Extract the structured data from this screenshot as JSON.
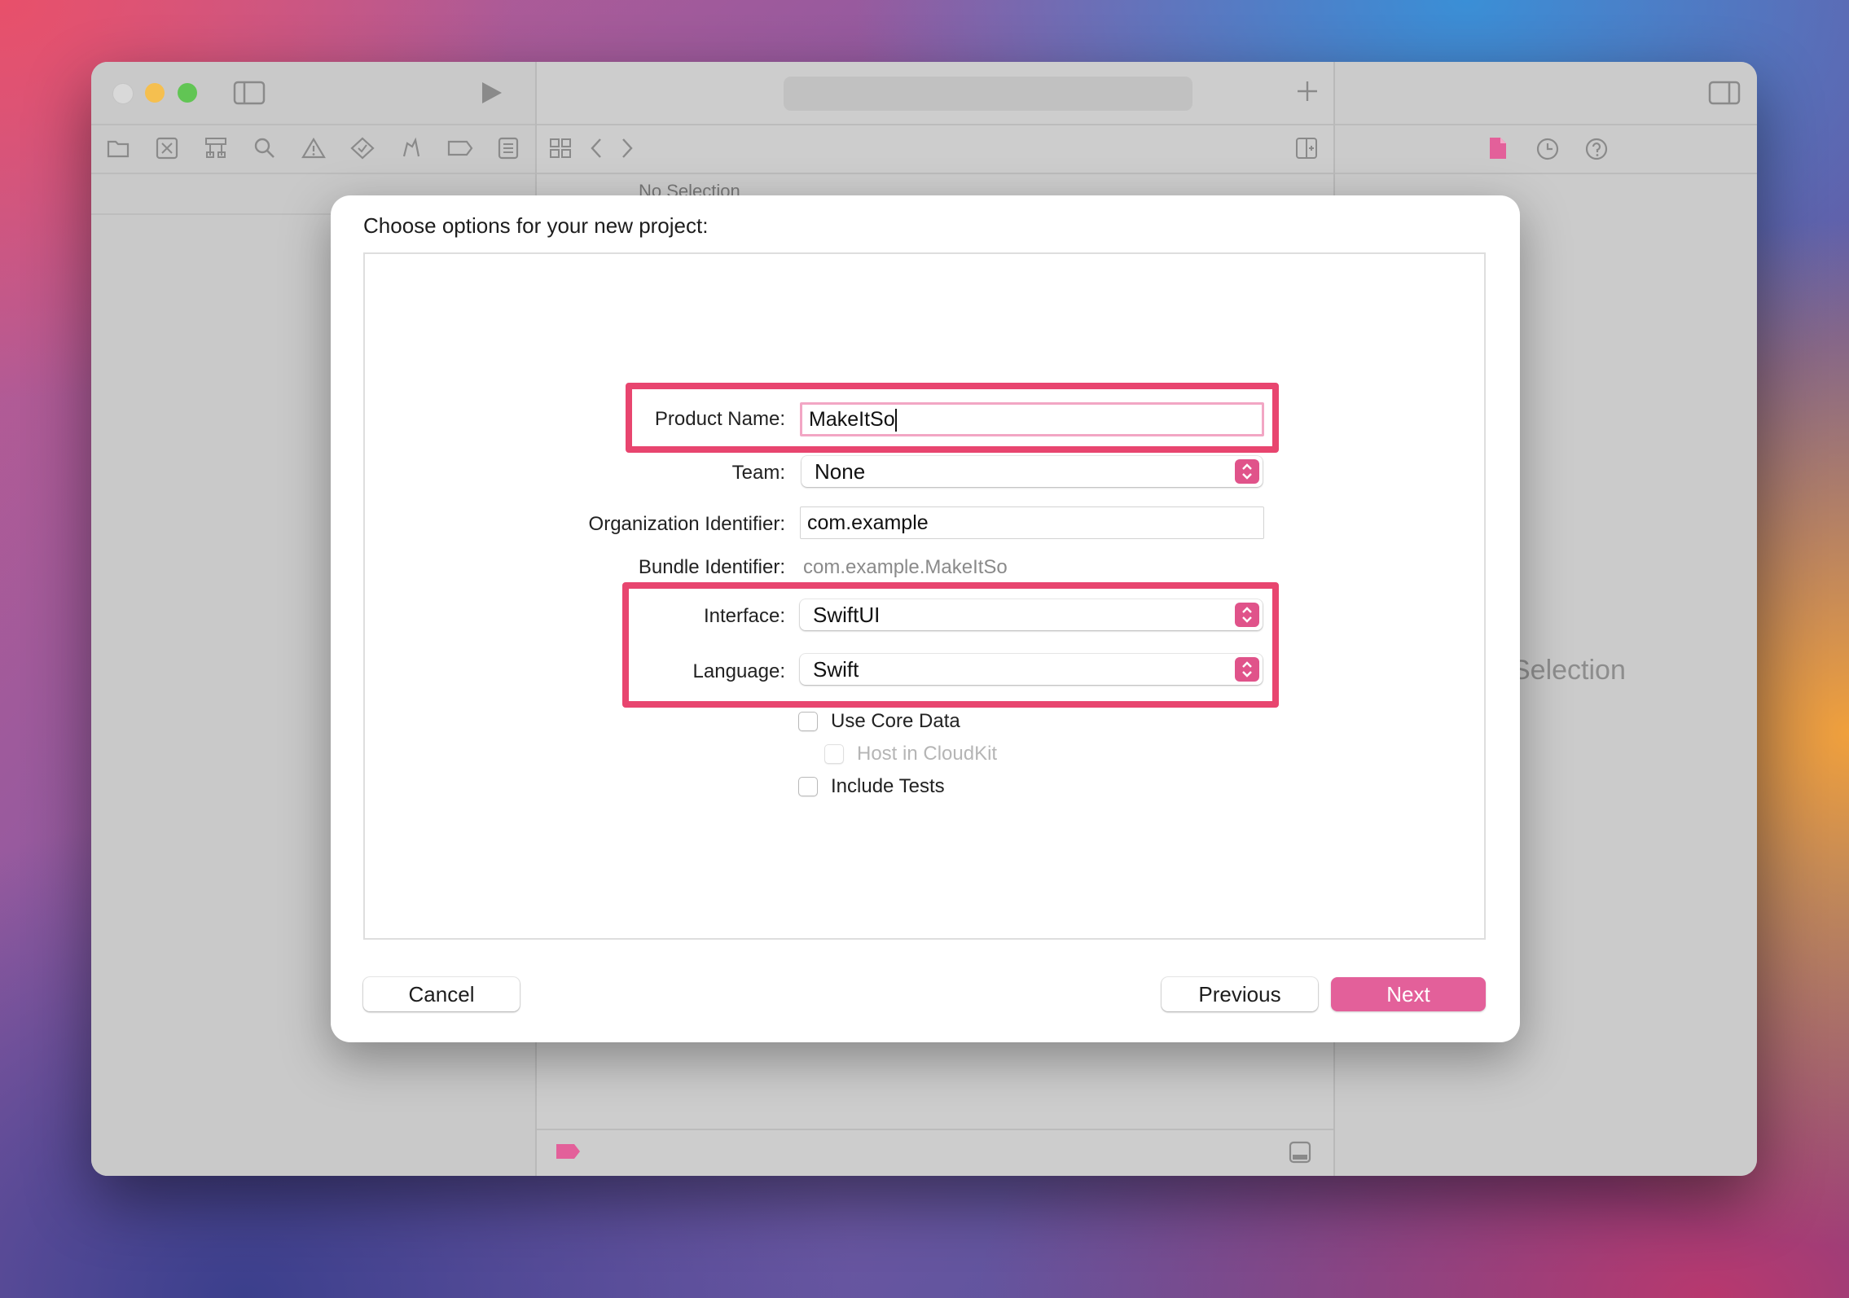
{
  "app": {
    "no_selection_top": "No Selection",
    "no_selection_right": "Selection"
  },
  "dialog": {
    "title": "Choose options for your new project:",
    "product_name": {
      "label": "Product Name:",
      "value": "MakeItSo"
    },
    "team": {
      "label": "Team:",
      "value": "None"
    },
    "organization_identifier": {
      "label": "Organization Identifier:",
      "value": "com.example"
    },
    "bundle_identifier": {
      "label": "Bundle Identifier:",
      "value": "com.example.MakeItSo"
    },
    "interface": {
      "label": "Interface:",
      "value": "SwiftUI"
    },
    "language": {
      "label": "Language:",
      "value": "Swift"
    },
    "use_core_data": {
      "label": "Use Core Data",
      "checked": false
    },
    "host_in_cloudkit": {
      "label": "Host in CloudKit",
      "checked": false,
      "enabled": false
    },
    "include_tests": {
      "label": "Include Tests",
      "checked": false
    },
    "buttons": {
      "cancel": "Cancel",
      "previous": "Previous",
      "next": "Next"
    }
  },
  "colors": {
    "accent": "#e3609a",
    "highlight": "#e8456f",
    "close": "#d8d8d8",
    "minimize": "#f5bf4f",
    "zoom": "#61c554"
  }
}
